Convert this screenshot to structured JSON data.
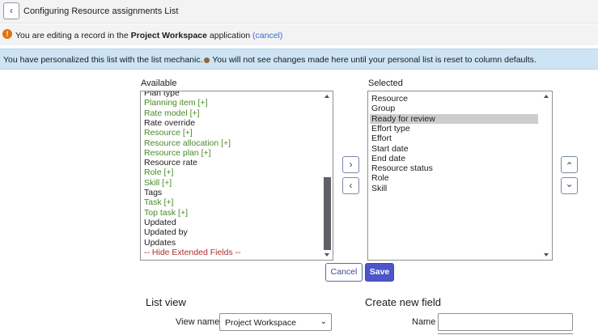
{
  "header": {
    "back_icon": "‹",
    "title": "Configuring Resource assignments List"
  },
  "notice": {
    "icon": "!",
    "prefix": "You are editing a record in the ",
    "app_name": "Project Workspace",
    "suffix": " application ",
    "cancel": "(cancel)"
  },
  "info": {
    "part1": "You have personalized this list with the list mechanic.",
    "part2": " You will not see changes made here until your personal list is reset to column defaults."
  },
  "available": {
    "label": "Available",
    "items": [
      {
        "text": "Plan type",
        "color": "dark"
      },
      {
        "text": "Planning item [+]",
        "color": "green"
      },
      {
        "text": "Rate model [+]",
        "color": "green"
      },
      {
        "text": "Rate override",
        "color": "dark"
      },
      {
        "text": "Resource [+]",
        "color": "green"
      },
      {
        "text": "Resource allocation [+]",
        "color": "green"
      },
      {
        "text": "Resource plan [+]",
        "color": "green"
      },
      {
        "text": "Resource rate",
        "color": "dark"
      },
      {
        "text": "Role [+]",
        "color": "green"
      },
      {
        "text": "Skill [+]",
        "color": "green"
      },
      {
        "text": "Tags",
        "color": "dark"
      },
      {
        "text": "Task [+]",
        "color": "green"
      },
      {
        "text": "Top task [+]",
        "color": "green"
      },
      {
        "text": "Updated",
        "color": "dark"
      },
      {
        "text": "Updated by",
        "color": "dark"
      },
      {
        "text": "Updates",
        "color": "dark"
      },
      {
        "text": "-- Hide Extended Fields --",
        "color": "red"
      }
    ]
  },
  "selected": {
    "label": "Selected",
    "items": [
      {
        "text": "Resource",
        "selected": false
      },
      {
        "text": "Group",
        "selected": false
      },
      {
        "text": "Ready for review",
        "selected": true
      },
      {
        "text": "Effort type",
        "selected": false
      },
      {
        "text": "Effort",
        "selected": false
      },
      {
        "text": "Start date",
        "selected": false
      },
      {
        "text": "End date",
        "selected": false
      },
      {
        "text": "Resource status",
        "selected": false
      },
      {
        "text": "Role",
        "selected": false
      },
      {
        "text": "Skill",
        "selected": false
      }
    ]
  },
  "move": {
    "add_icon": "›",
    "remove_icon": "‹",
    "up_icon": "⌃",
    "down_icon": "⌄"
  },
  "buttons": {
    "cancel": "Cancel",
    "save": "Save"
  },
  "list_view": {
    "title": "List view",
    "view_name_label": "View name",
    "view_name_value": "Project Workspace",
    "chevron": "⌄"
  },
  "new_field": {
    "title": "Create new field",
    "name_label": "Name",
    "name_value": ""
  }
}
